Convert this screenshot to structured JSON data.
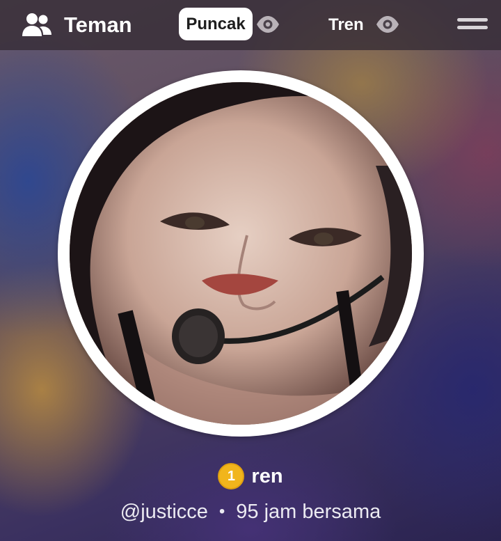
{
  "header": {
    "friends_label": "Teman",
    "tabs": [
      {
        "label": "Puncak",
        "active": true
      },
      {
        "label": "Tren",
        "active": false
      }
    ]
  },
  "profile": {
    "rank": "1",
    "name": "ren",
    "handle": "@justicce",
    "separator": "•",
    "hours_text": "95 jam bersama"
  },
  "icons": {
    "friends": "friends-icon",
    "eye": "eye-icon",
    "menu": "menu-icon",
    "rank": "rank-badge"
  },
  "colors": {
    "header_bg": "#342c34",
    "active_tab_bg": "#ffffff",
    "rank_badge": "#f1b51c",
    "text": "#ffffff"
  }
}
